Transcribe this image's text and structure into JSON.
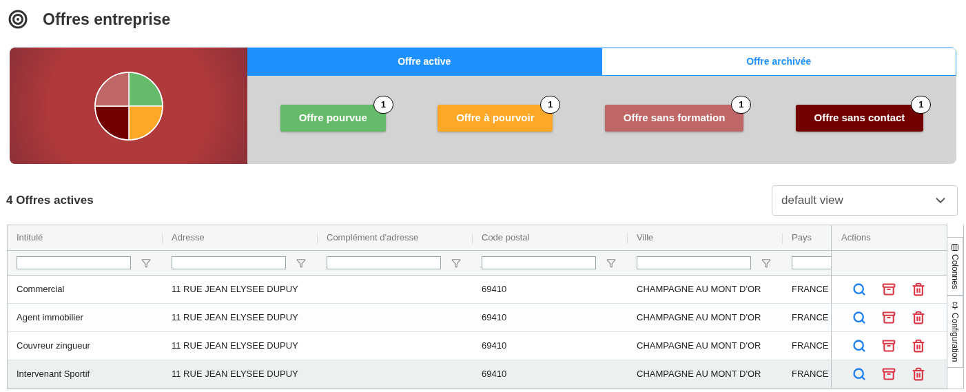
{
  "page": {
    "title": "Offres entreprise"
  },
  "tabs": [
    {
      "label": "Offre active",
      "selected": true
    },
    {
      "label": "Offre archivée",
      "selected": false
    }
  ],
  "categories": [
    {
      "label": "Offre pourvue",
      "count": "1",
      "color": "#66bb6a"
    },
    {
      "label": "Offre à pourvoir",
      "count": "1",
      "color": "#ffa726"
    },
    {
      "label": "Offre sans formation",
      "count": "1",
      "color": "#bf6666"
    },
    {
      "label": "Offre sans contact",
      "count": "1",
      "color": "#730000"
    }
  ],
  "list": {
    "heading": "4 Offres actives",
    "view_select": {
      "value": "default view"
    }
  },
  "table": {
    "columns": [
      "Intitulé",
      "Adresse",
      "Complément d'adresse",
      "Code postal",
      "Ville",
      "Pays",
      "Actions"
    ],
    "rows": [
      {
        "cells": [
          "Commercial",
          "11 RUE JEAN ELYSEE DUPUY",
          "",
          "69410",
          "CHAMPAGNE AU MONT D'OR",
          "FRANCE"
        ],
        "selected": false
      },
      {
        "cells": [
          "Agent immobilier",
          "11 RUE JEAN ELYSEE DUPUY",
          "",
          "69410",
          "CHAMPAGNE AU MONT D'OR",
          "FRANCE"
        ],
        "selected": false
      },
      {
        "cells": [
          "Couvreur zingueur",
          "11 RUE JEAN ELYSEE DUPUY",
          "",
          "69410",
          "CHAMPAGNE AU MONT D'OR",
          "FRANCE"
        ],
        "selected": false
      },
      {
        "cells": [
          "Intervenant Sportif",
          "11 RUE JEAN ELYSEE DUPUY",
          "",
          "69410",
          "CHAMPAGNE AU MONT D'OR",
          "FRANCE"
        ],
        "selected": true
      }
    ]
  },
  "side_panel": {
    "tabs": [
      "Colonnes",
      "Configuration"
    ]
  }
}
